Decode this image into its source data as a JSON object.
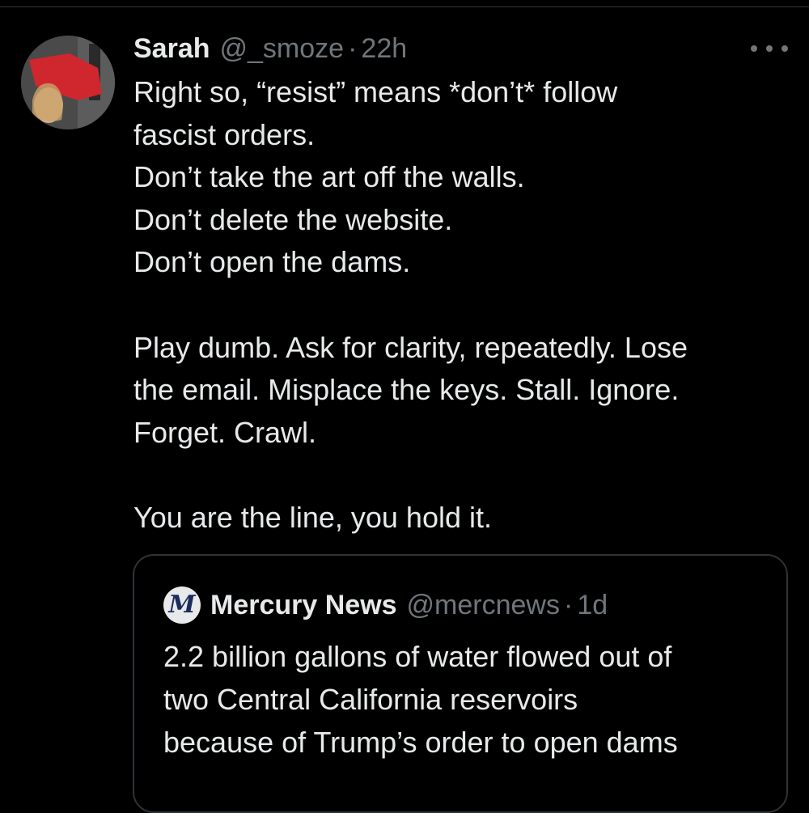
{
  "tweet": {
    "author": {
      "display_name": "Sarah",
      "handle": "@_smoze",
      "separator": "·",
      "time": "22h"
    },
    "more_icon": "more-horizontal-icon",
    "text_lines": [
      "Right so, “resist” means *don’t* follow",
      "fascist orders.",
      "Don’t take the art off the walls.",
      "Don’t delete the website.",
      "Don’t open the dams.",
      "",
      "Play dumb. Ask for clarity, repeatedly. Lose",
      "the email. Misplace the keys. Stall. Ignore.",
      "Forget. Crawl.",
      "",
      "You are the line, you hold it."
    ]
  },
  "quote": {
    "logo_letter": "M",
    "display_name": "Mercury News",
    "handle": "@mercnews",
    "separator": "·",
    "time": "1d",
    "text_lines": [
      "2.2 billion gallons of water flowed out of",
      "two Central California reservoirs",
      "because of Trump’s order to open dams"
    ]
  },
  "colors": {
    "background": "#000000",
    "text_primary": "#e7e9ea",
    "text_secondary": "#71767b",
    "border": "#2f3336"
  }
}
